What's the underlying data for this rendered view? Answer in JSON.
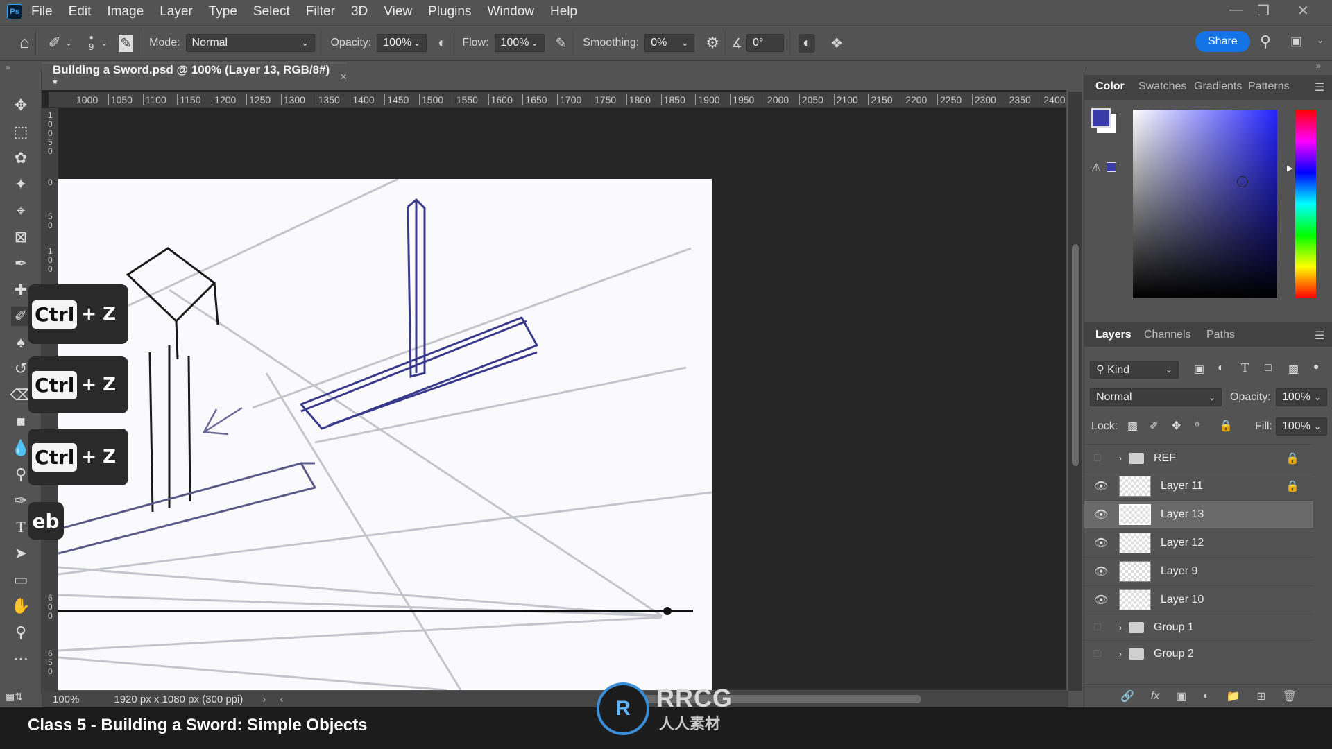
{
  "app": {
    "logo": "Ps"
  },
  "menu": [
    "File",
    "Edit",
    "Image",
    "Layer",
    "Type",
    "Select",
    "Filter",
    "3D",
    "View",
    "Plugins",
    "Window",
    "Help"
  ],
  "options": {
    "brush_size": "9",
    "mode_label": "Mode:",
    "mode_value": "Normal",
    "opacity_label": "Opacity:",
    "opacity_value": "100%",
    "flow_label": "Flow:",
    "flow_value": "100%",
    "smoothing_label": "Smoothing:",
    "smoothing_value": "0%",
    "angle_value": "0°",
    "share_label": "Share"
  },
  "document": {
    "tab_title": "Building a Sword.psd @ 100% (Layer 13, RGB/8#) *",
    "close": "×",
    "zoom": "100%",
    "dimensions": "1920 px x 1080 px (300 ppi)"
  },
  "ruler": {
    "h_ticks": [
      "1000",
      "1050",
      "1100",
      "1150",
      "1200",
      "1250",
      "1300",
      "1350",
      "1400",
      "1450",
      "1500",
      "1550",
      "1600",
      "1650",
      "1700",
      "1750",
      "1800",
      "1850",
      "1900",
      "1950",
      "2000",
      "2050",
      "2100",
      "2150",
      "2200",
      "2250",
      "2300",
      "2350",
      "2400"
    ]
  },
  "color_panel": {
    "tabs": [
      "Color",
      "Swatches",
      "Gradients",
      "Patterns"
    ],
    "foreground": "#3a3aa8",
    "background": "#ffffff"
  },
  "layers_panel": {
    "tabs": [
      "Layers",
      "Channels",
      "Paths"
    ],
    "kind_label": "Kind",
    "blend_mode": "Normal",
    "opacity_label": "Opacity:",
    "opacity_value": "100%",
    "lock_label": "Lock:",
    "fill_label": "Fill:",
    "fill_value": "100%",
    "layers": [
      {
        "name": "REF",
        "type": "group",
        "visible": false,
        "locked": true
      },
      {
        "name": "Layer 11",
        "type": "layer",
        "visible": true,
        "locked": true
      },
      {
        "name": "Layer 13",
        "type": "layer",
        "visible": true,
        "selected": true
      },
      {
        "name": "Layer 12",
        "type": "layer",
        "visible": true
      },
      {
        "name": "Layer 9",
        "type": "layer",
        "visible": true
      },
      {
        "name": "Layer 10",
        "type": "layer",
        "visible": true
      },
      {
        "name": "Group 1",
        "type": "group",
        "visible": false
      },
      {
        "name": "Group 2",
        "type": "group",
        "visible": false
      }
    ]
  },
  "overlay": {
    "shortcuts": [
      {
        "key": "Ctrl",
        "plus": "+ Z"
      },
      {
        "key": "Ctrl",
        "plus": "+ Z"
      },
      {
        "key": "Ctrl",
        "plus": "+ Z"
      }
    ],
    "badge": "eb"
  },
  "footer": {
    "caption": "Class 5 - Building a Sword: Simple Objects",
    "watermark_main": "RRCG",
    "watermark_sub": "人人素材"
  }
}
